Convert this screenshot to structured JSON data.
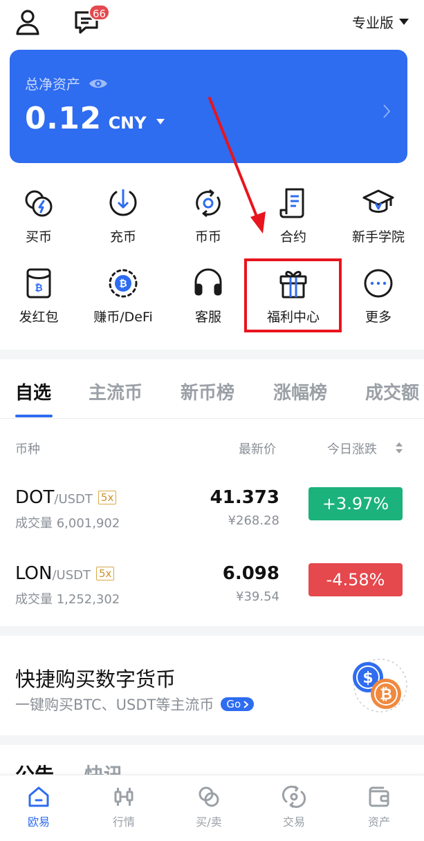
{
  "header": {
    "message_badge": "66",
    "mode_label": "专业版"
  },
  "asset": {
    "label": "总净资产",
    "value": "0.12",
    "currency": "CNY"
  },
  "shortcuts": [
    {
      "label": "买币",
      "icon": "buy-coin-icon"
    },
    {
      "label": "充币",
      "icon": "deposit-icon"
    },
    {
      "label": "币币",
      "icon": "spot-icon"
    },
    {
      "label": "合约",
      "icon": "contract-icon"
    },
    {
      "label": "新手学院",
      "icon": "academy-icon"
    },
    {
      "label": "发红包",
      "icon": "red-packet-icon"
    },
    {
      "label": "赚币/DeFi",
      "icon": "earn-icon"
    },
    {
      "label": "客服",
      "icon": "headset-icon"
    },
    {
      "label": "福利中心",
      "icon": "gift-icon"
    },
    {
      "label": "更多",
      "icon": "more-icon"
    }
  ],
  "market_tabs": [
    "自选",
    "主流币",
    "新币榜",
    "涨幅榜",
    "成交额"
  ],
  "table_headers": {
    "pair": "币种",
    "price": "最新价",
    "change": "今日涨跌"
  },
  "market_rows": [
    {
      "base": "DOT",
      "quote": "/USDT",
      "leverage": "5x",
      "volume": "成交量 6,001,902",
      "price": "41.373",
      "price_cny": "¥268.28",
      "change": "+3.97%",
      "direction": "up"
    },
    {
      "base": "LON",
      "quote": "/USDT",
      "leverage": "5x",
      "volume": "成交量 1,252,302",
      "price": "6.098",
      "price_cny": "¥39.54",
      "change": "-4.58%",
      "direction": "down"
    }
  ],
  "promo": {
    "title": "快捷购买数字货币",
    "subtitle": "一键购买BTC、USDT等主流币",
    "go_label": "Go"
  },
  "announcement_tabs": [
    "公告",
    "快讯"
  ],
  "bottom_nav": [
    {
      "label": "欧易",
      "icon": "home-icon"
    },
    {
      "label": "行情",
      "icon": "market-icon"
    },
    {
      "label": "买/卖",
      "icon": "buy-sell-icon"
    },
    {
      "label": "交易",
      "icon": "trade-icon"
    },
    {
      "label": "资产",
      "icon": "wallet-icon"
    }
  ],
  "colors": {
    "brand_blue": "#2e6cf0",
    "up_green": "#1bb27c",
    "down_red": "#e5484d",
    "annotation_red": "#e8141e",
    "leverage_gold": "#c8932e"
  }
}
